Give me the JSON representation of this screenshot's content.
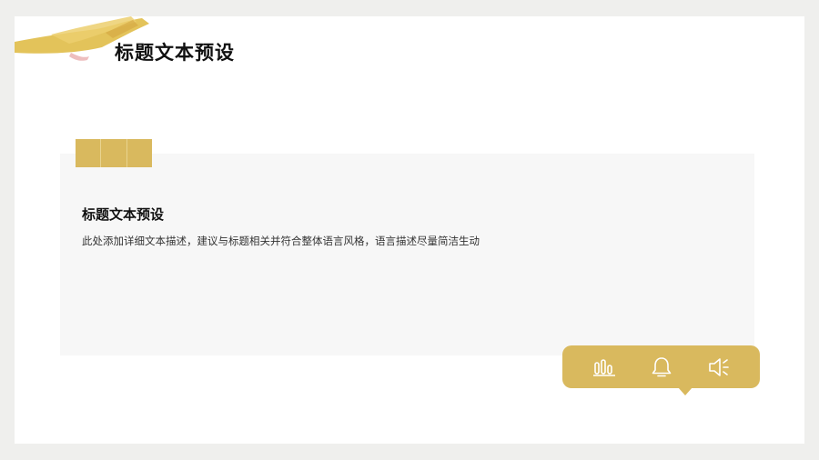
{
  "slide": {
    "title": "标题文本预设",
    "card": {
      "title": "标题文本预设",
      "description": "此处添加详细文本描述，建议与标题相关并符合整体语言风格，语言描述尽量简洁生动"
    }
  },
  "toolbar": {
    "icons": [
      "bar-chart-icon",
      "bell-icon",
      "speaker-icon"
    ]
  },
  "colors": {
    "accent": "#d9b95e",
    "card_background": "#f7f7f7",
    "page_background": "#efefed"
  }
}
